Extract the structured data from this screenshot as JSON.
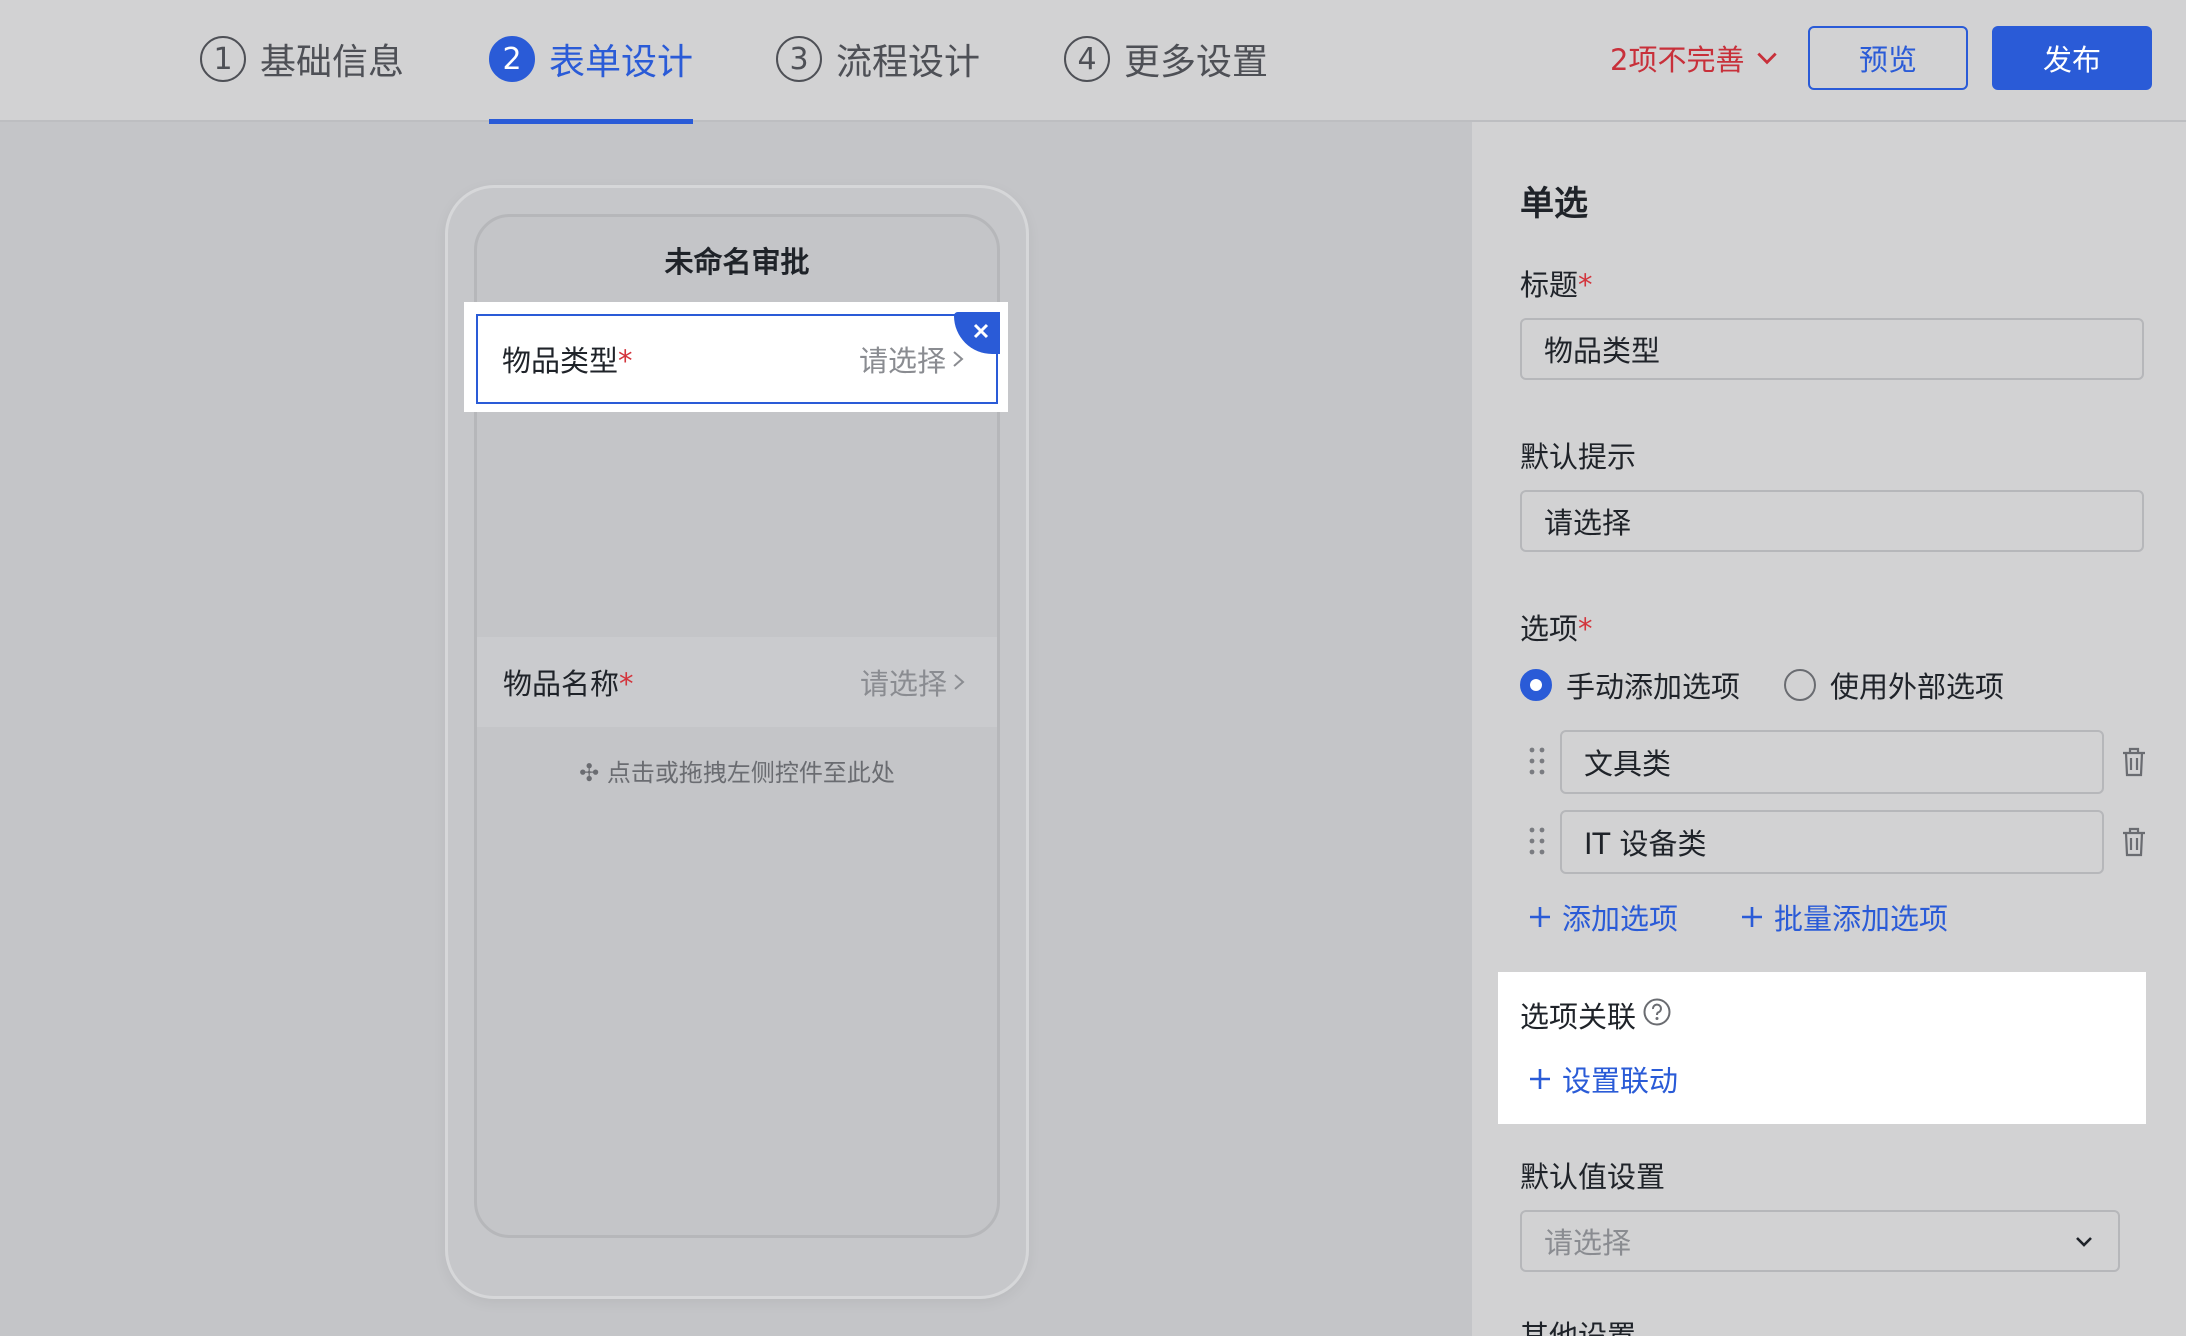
{
  "steps": [
    {
      "num": "1",
      "label": "基础信息"
    },
    {
      "num": "2",
      "label": "表单设计"
    },
    {
      "num": "3",
      "label": "流程设计"
    },
    {
      "num": "4",
      "label": "更多设置"
    }
  ],
  "header": {
    "incomplete_label": "2项不完善",
    "preview_label": "预览",
    "publish_label": "发布"
  },
  "phone": {
    "title": "未命名审批",
    "fields": [
      {
        "label": "物品类型",
        "required_mark": "*",
        "placeholder": "请选择"
      },
      {
        "label": "物品名称",
        "required_mark": "*",
        "placeholder": "请选择"
      }
    ],
    "drop_hint": "点击或拖拽左侧控件至此处"
  },
  "panel": {
    "title": "单选",
    "title_label": "标题",
    "title_required": "*",
    "title_value": "物品类型",
    "hint_label": "默认提示",
    "hint_value": "请选择",
    "options_label": "选项",
    "options_required": "*",
    "radio_manual": "手动添加选项",
    "radio_external": "使用外部选项",
    "options": [
      "文具类",
      "IT 设备类"
    ],
    "add_option": "添加选项",
    "batch_add_option": "批量添加选项",
    "assoc_label": "选项关联",
    "set_linkage": "设置联动",
    "default_label": "默认值设置",
    "default_placeholder": "请选择",
    "cut_label": "其他设置"
  },
  "colors": {
    "accent": "#2a5bd7",
    "required": "#d3343c",
    "warning_text": "#c8303a"
  }
}
